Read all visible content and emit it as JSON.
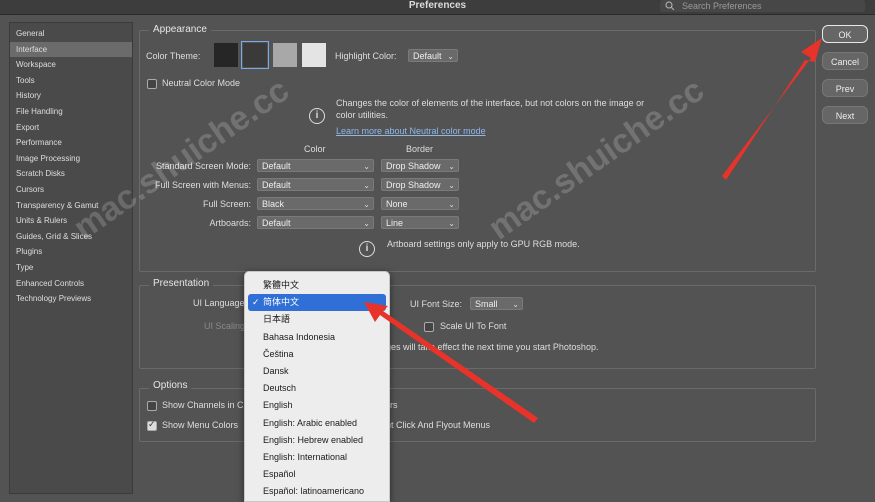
{
  "window": {
    "title": "Preferences"
  },
  "search": {
    "placeholder": "Search Preferences"
  },
  "sidebar": {
    "items": [
      {
        "label": "General"
      },
      {
        "label": "Interface",
        "selected": true
      },
      {
        "label": "Workspace"
      },
      {
        "label": "Tools"
      },
      {
        "label": "History"
      },
      {
        "label": "File Handling"
      },
      {
        "label": "Export"
      },
      {
        "label": "Performance"
      },
      {
        "label": "Image Processing"
      },
      {
        "label": "Scratch Disks"
      },
      {
        "label": "Cursors"
      },
      {
        "label": "Transparency & Gamut"
      },
      {
        "label": "Units & Rulers"
      },
      {
        "label": "Guides, Grid & Slices"
      },
      {
        "label": "Plugins"
      },
      {
        "label": "Type"
      },
      {
        "label": "Enhanced Controls"
      },
      {
        "label": "Technology Previews"
      }
    ]
  },
  "appearance": {
    "legend": "Appearance",
    "color_theme_label": "Color Theme:",
    "theme_swatches": [
      "#262626",
      "#3a3a3a",
      "#a8a8a8",
      "#e4e4e4"
    ],
    "highlight_label": "Highlight Color:",
    "highlight_value": "Default",
    "neutral_mode_label": "Neutral Color Mode",
    "neutral_info": "Changes the color of elements of the interface, but not colors on the image or color utilities.",
    "neutral_link": "Learn more about Neutral color mode",
    "col_color": "Color",
    "col_border": "Border",
    "rows": [
      {
        "label": "Standard Screen Mode:",
        "color": "Default",
        "border": "Drop Shadow"
      },
      {
        "label": "Full Screen with Menus:",
        "color": "Default",
        "border": "Drop Shadow"
      },
      {
        "label": "Full Screen:",
        "color": "Black",
        "border": "None"
      },
      {
        "label": "Artboards:",
        "color": "Default",
        "border": "Line"
      }
    ],
    "artboard_info": "Artboard settings only apply to GPU RGB mode."
  },
  "presentation": {
    "legend": "Presentation",
    "ui_language_label": "UI Language",
    "ui_scaling_label": "UI Scaling",
    "font_size_label": "UI Font Size:",
    "font_size_value": "Small",
    "scale_ui_label": "Scale UI To Font",
    "restart_note": "ges will take effect the next time you start Photoshop."
  },
  "options": {
    "legend": "Options",
    "show_channels_label": "Show Channels in C",
    "show_channels_tail": "rs",
    "show_menu_colors_label": "Show Menu Colors",
    "right_click_tail": "ht Click And Flyout Menus"
  },
  "buttons": {
    "ok": "OK",
    "cancel": "Cancel",
    "prev": "Prev",
    "next": "Next"
  },
  "language_menu": {
    "items": [
      {
        "label": "繁體中文"
      },
      {
        "label": "简体中文",
        "selected": true
      },
      {
        "label": "日本語"
      },
      {
        "label": "Bahasa Indonesia"
      },
      {
        "label": "Čeština"
      },
      {
        "label": "Dansk"
      },
      {
        "label": "Deutsch"
      },
      {
        "label": "English"
      },
      {
        "label": "English: Arabic enabled"
      },
      {
        "label": "English: Hebrew enabled"
      },
      {
        "label": "English: International"
      },
      {
        "label": "Español"
      },
      {
        "label": "Español: latinoamericano"
      }
    ],
    "check": "✓"
  },
  "watermark": "mac.shuiche.cc",
  "colors": {
    "arrow": "#e8332a",
    "selection": "#2f6fd6"
  }
}
